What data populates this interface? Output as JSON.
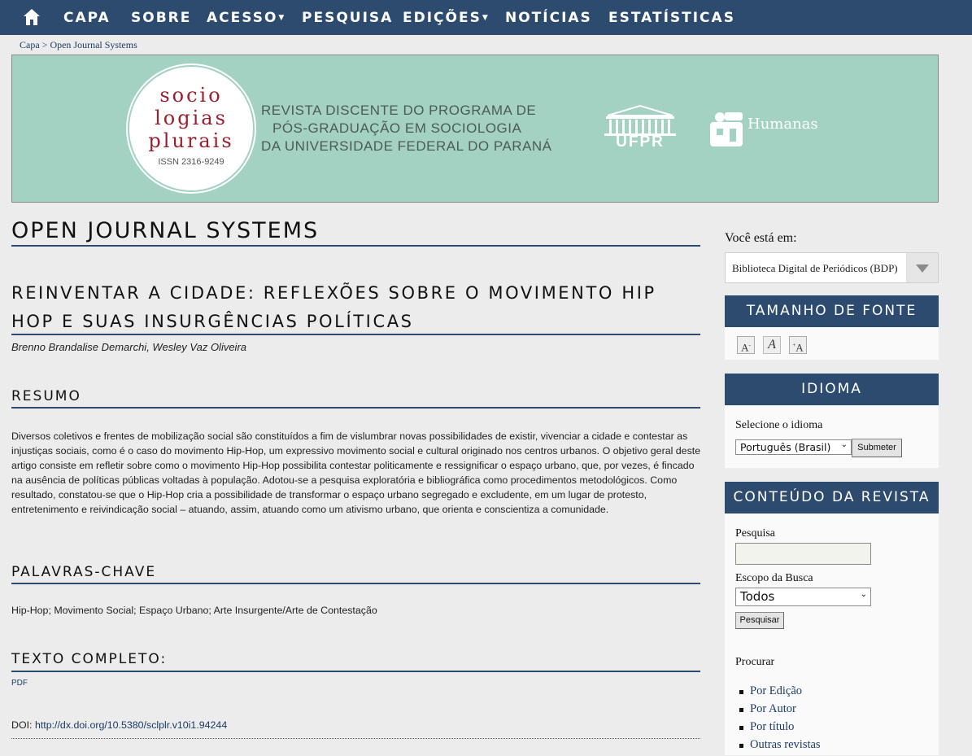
{
  "nav": {
    "items": [
      {
        "label": "CAPA"
      },
      {
        "label": "SOBRE"
      },
      {
        "label": "ACESSO",
        "dropdown": true
      },
      {
        "label": "PESQUISA"
      },
      {
        "label": "EDIÇÕES",
        "dropdown": true
      },
      {
        "label": "NOTÍCIAS"
      },
      {
        "label": "ESTATÍSTICAS"
      }
    ],
    "home_icon": "home-icon"
  },
  "breadcrumb": {
    "home": "Capa",
    "separator": ">",
    "current": "Open Journal Systems"
  },
  "banner": {
    "logo_lines": [
      "socio",
      "logias",
      "plurais"
    ],
    "issn": "ISSN 2316-9249",
    "tagline": [
      "REVISTA DISCENTE DO  PROGRAMA DE",
      "PÓS-GRADUAÇÃO EM SOCIOLOGIA",
      "DA UNIVERSIDADE FEDERAL DO PARANÁ"
    ],
    "ufpr_label": "UFPR",
    "humanas_label": "Humanas",
    "bg_color": "#a3d2c2"
  },
  "page_title": "OPEN JOURNAL SYSTEMS",
  "article": {
    "title": "REINVENTAR A CIDADE: REFLEXÕES SOBRE O MOVIMENTO HIP HOP E SUAS INSURGÊNCIAS POLÍTICAS",
    "authors": "Brenno Brandalise Demarchi, Wesley Vaz Oliveira",
    "abstract_heading": "RESUMO",
    "abstract": "Diversos coletivos e frentes de mobilização social são constituídos a fim de vislumbrar novas possibilidades de existir, vivenciar a cidade e contestar as injustiças sociais, como é o caso do movimento Hip-Hop, um expressivo movimento social e cultural originado nos centros urbanos. O objetivo geral deste artigo consiste em refletir sobre como o movimento Hip-Hop possibilita contestar politicamente e ressignificar o espaço urbano, que, por vezes, é fincado na ausência de políticas públicas voltadas à população. Adotou-se a pesquisa exploratória e bibliográfica como procedimentos metodológicos. Como resultado, constatou-se que o Hip-Hop cria a possibilidade de transformar o espaço urbano segregado e excludente, em um lugar de protesto, entretenimento e reivindicação social – atuando, assim, atuando como um ativismo urbano, que orienta e conscientiza a comunidade.",
    "keywords_heading": "PALAVRAS-CHAVE",
    "keywords": "Hip-Hop; Movimento Social; Espaço Urbano; Arte Insurgente/Arte de Contestação",
    "fulltext_heading": "TEXTO COMPLETO:",
    "pdf_label": "PDF",
    "doi_label": "DOI:",
    "doi_link": "http://dx.doi.org/10.5380/sclplr.v10i1.94244"
  },
  "sidebar": {
    "location_label": "Você está em:",
    "location_value": "Biblioteca Digital de Periódicos (BDP)",
    "font_size_heading": "TAMANHO DE FONTE",
    "font_size_icons": [
      "font-smaller-icon",
      "font-default-icon",
      "font-larger-icon"
    ],
    "language_heading": "IDIOMA",
    "language_label": "Selecione o idioma",
    "language_value": "Português (Brasil)",
    "submit_label": "Submeter",
    "content_heading": "CONTEÚDO DA REVISTA",
    "search_label": "Pesquisa",
    "scope_label": "Escopo da Busca",
    "scope_value": "Todos",
    "search_button": "Pesquisar",
    "browse_label": "Procurar",
    "browse_links": [
      "Por Edição",
      "Por Autor",
      "Por título",
      "Outras revistas"
    ]
  },
  "colors": {
    "nav": "#2c4b6e",
    "accent": "#2c4b6e",
    "link": "#1b3b66",
    "logo_text": "#9c1f2e"
  }
}
